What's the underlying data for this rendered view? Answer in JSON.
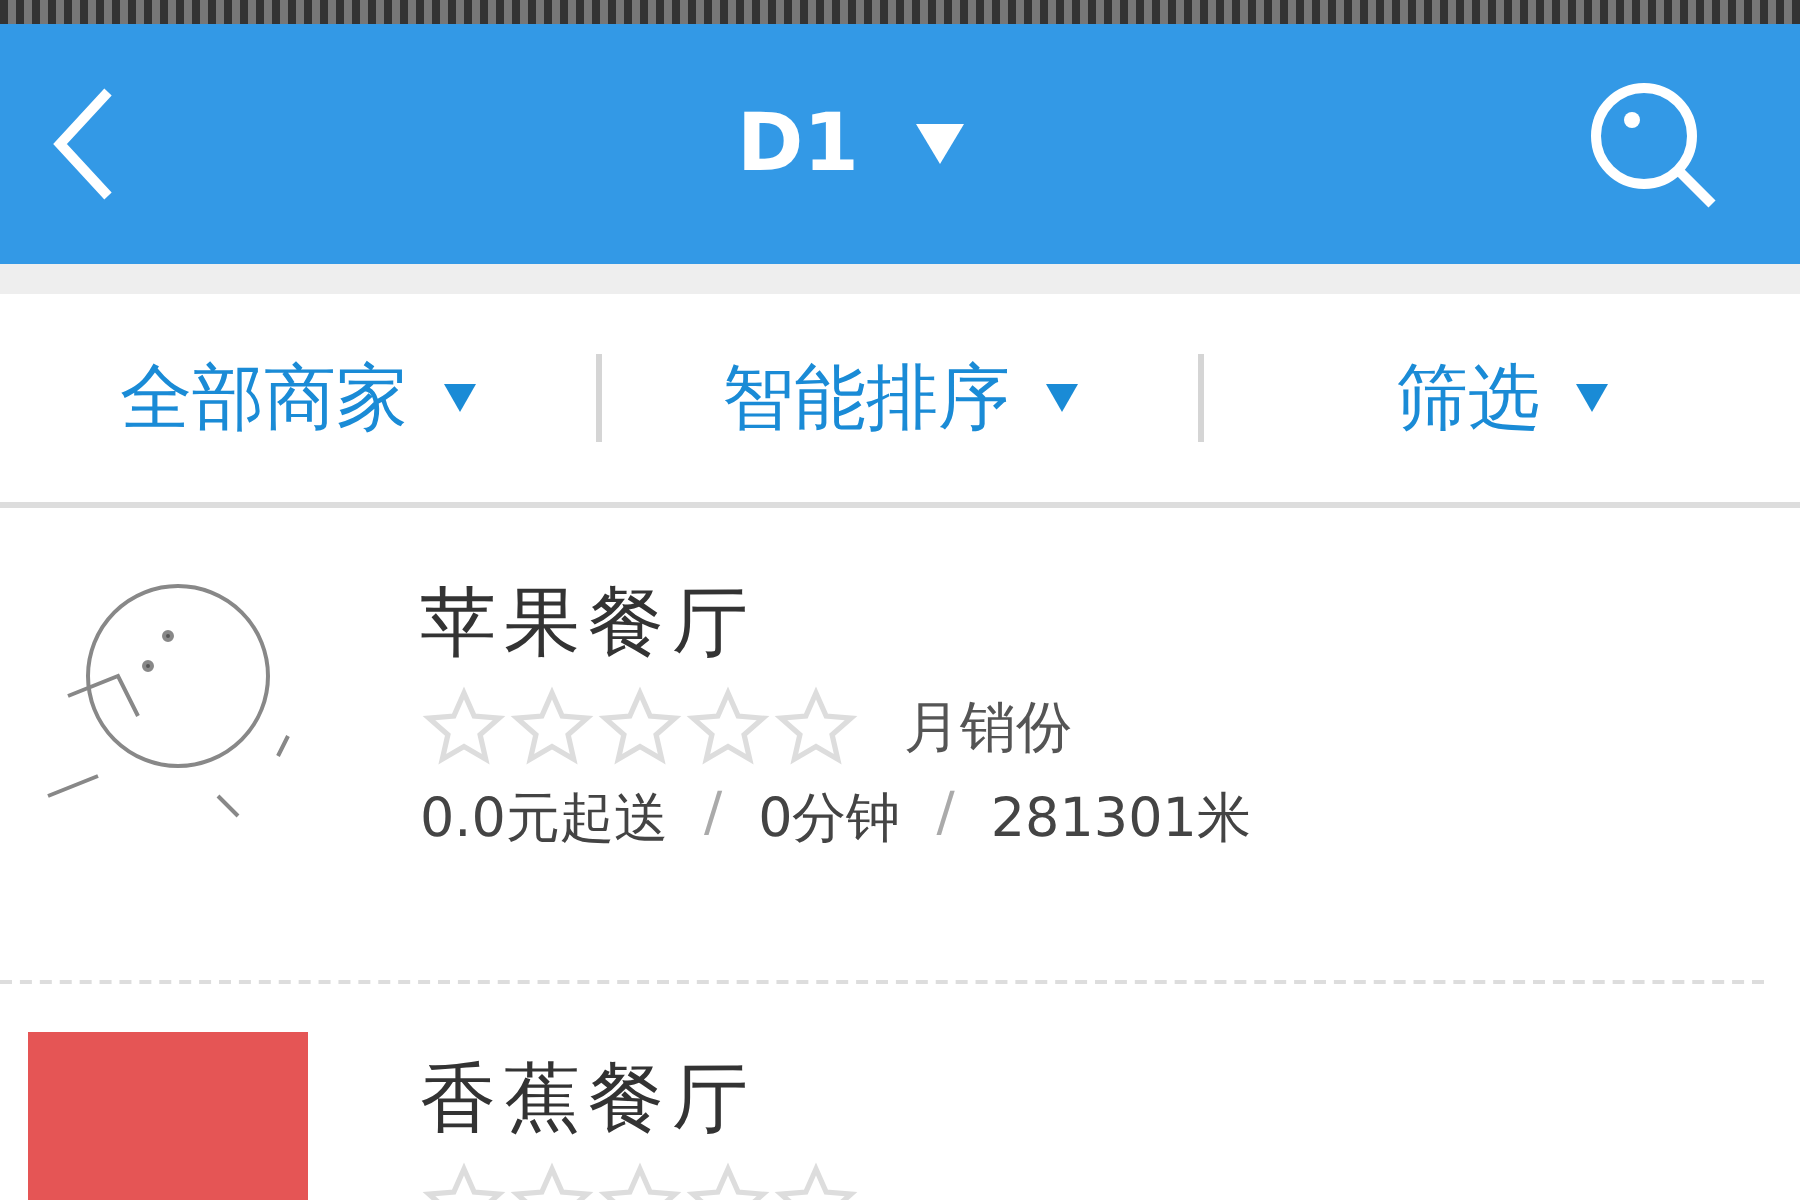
{
  "header": {
    "title": "D1"
  },
  "filters": [
    {
      "label": "全部商家"
    },
    {
      "label": "智能排序"
    },
    {
      "label": "筛选"
    }
  ],
  "restaurants": [
    {
      "name": "苹果餐厅",
      "stars": 0,
      "sales_label": "月销份",
      "min_order": "0.0元起送",
      "delivery_time": "0分钟",
      "distance": "281301米",
      "separators": [
        "/",
        "/"
      ],
      "kind": "sketch"
    },
    {
      "name": "香蕉餐厅",
      "stars": 0,
      "kind": "red"
    }
  ]
}
